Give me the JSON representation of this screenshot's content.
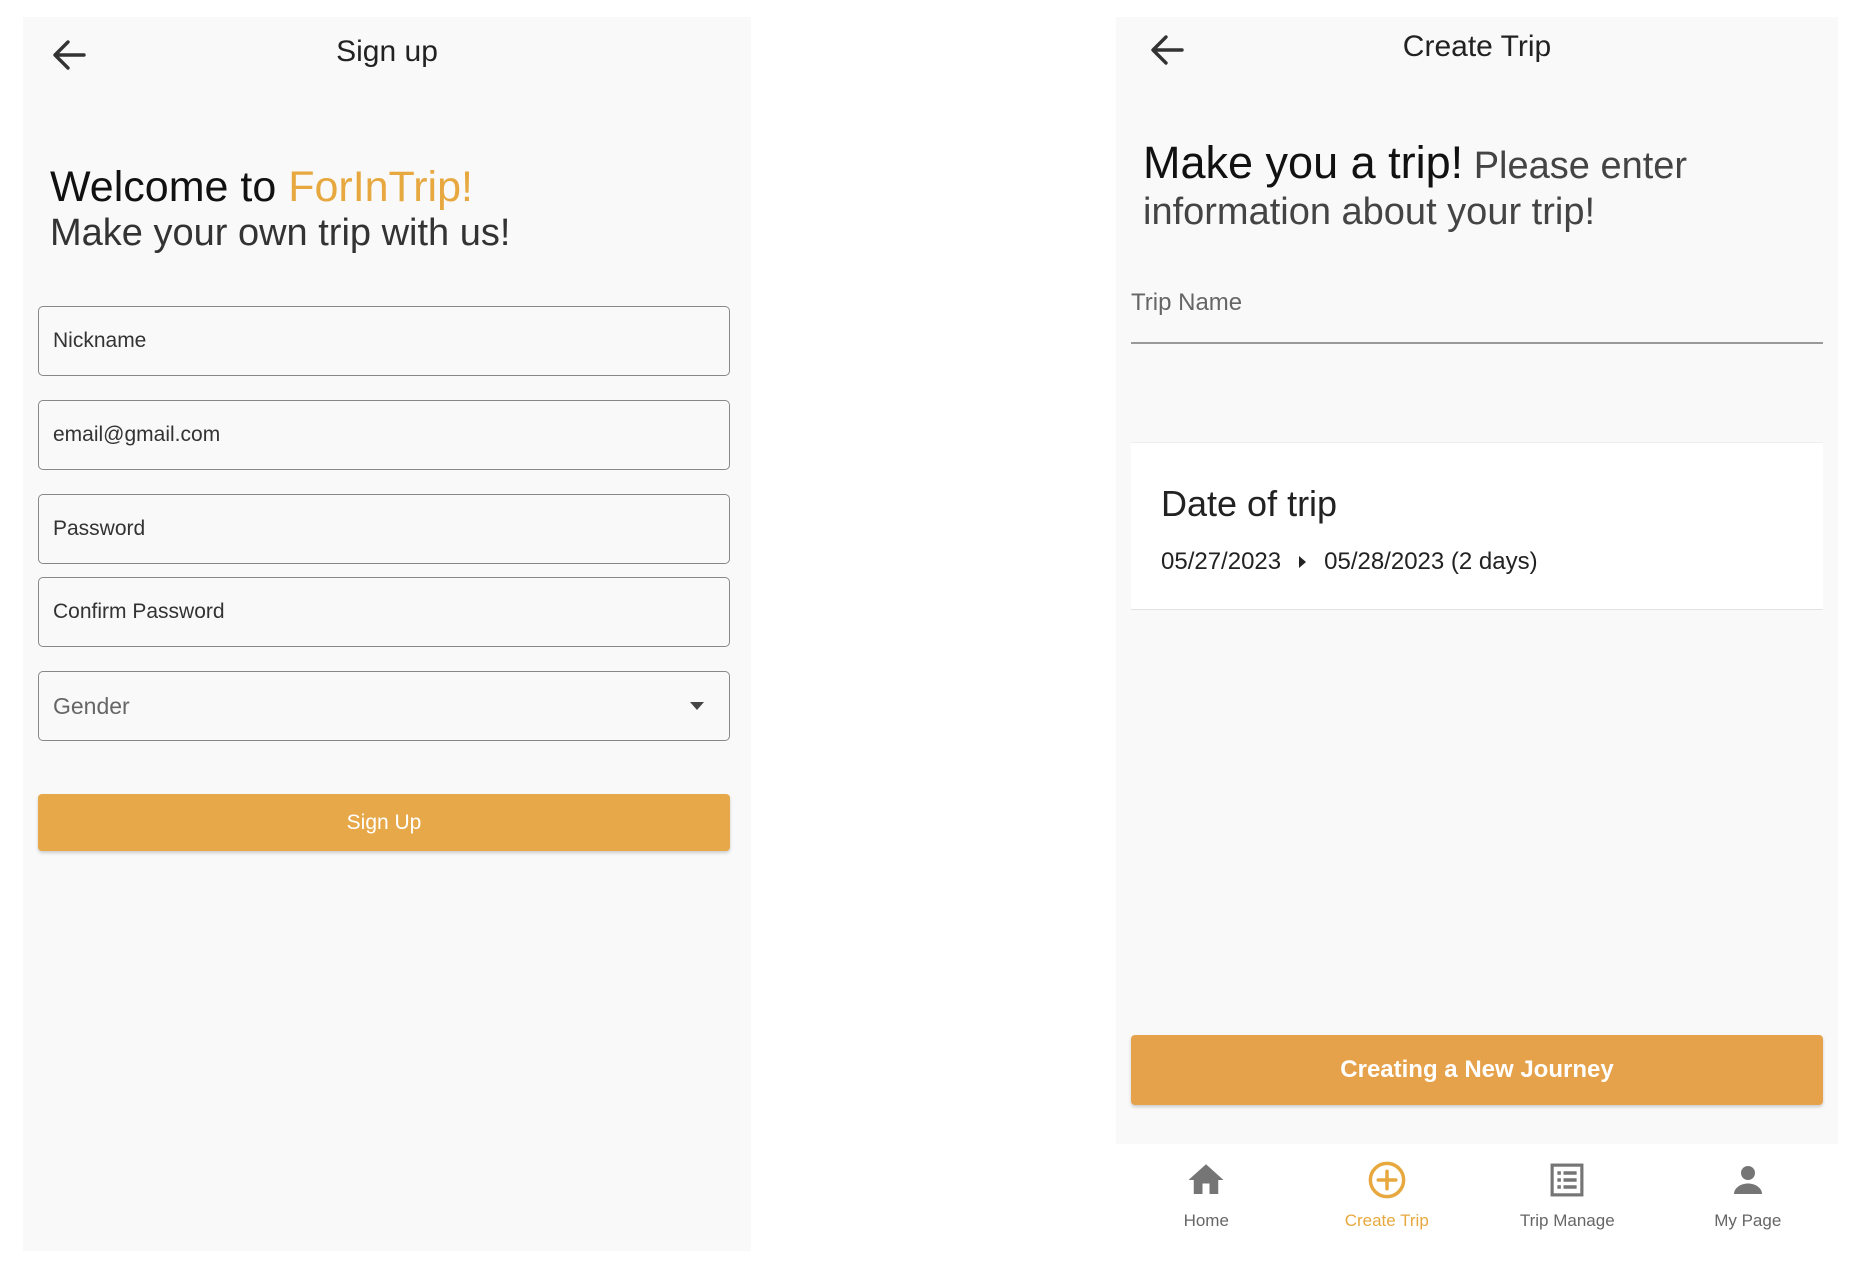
{
  "signup": {
    "title": "Sign up",
    "welcome_prefix": "Welcome to ",
    "brand": "ForInTrip!",
    "subtitle": "Make your own trip with us!",
    "fields": {
      "nickname_placeholder": "Nickname",
      "email_placeholder": "email@gmail.com",
      "password_placeholder": "Password",
      "confirm_password_placeholder": "Confirm Password",
      "gender_placeholder": "Gender"
    },
    "submit_label": "Sign Up"
  },
  "create_trip": {
    "title": "Create Trip",
    "intro_big": "Make you a trip!",
    "intro_small": " Please enter information about your trip!",
    "trip_name_label": "Trip Name",
    "date_card": {
      "title": "Date of trip",
      "start": "05/27/2023",
      "end_with_duration": "05/28/2023 (2 days)"
    },
    "submit_label": "Creating a New Journey"
  },
  "bottom_nav": {
    "items": [
      {
        "label": "Home",
        "icon": "home-icon"
      },
      {
        "label": "Create Trip",
        "icon": "add-circle-icon",
        "active": true
      },
      {
        "label": "Trip Manage",
        "icon": "list-icon"
      },
      {
        "label": "My Page",
        "icon": "person-icon"
      }
    ]
  },
  "colors": {
    "accent": "#e7a83f",
    "button": "#e7a84a",
    "screen_bg": "#f9f9f9",
    "text": "#222222"
  }
}
